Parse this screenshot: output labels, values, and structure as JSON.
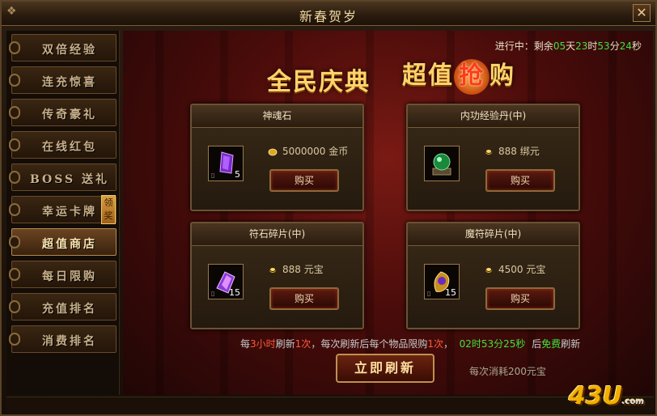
{
  "window": {
    "title": "新春贺岁",
    "close_label": "✕"
  },
  "sidebar": {
    "items": [
      {
        "label": "双倍经验"
      },
      {
        "label": "连充惊喜"
      },
      {
        "label": "传奇豪礼"
      },
      {
        "label": "在线红包"
      },
      {
        "label": "BOSS 送礼"
      },
      {
        "label": "幸运卡牌"
      },
      {
        "label": "超值商店"
      },
      {
        "label": "每日限购"
      },
      {
        "label": "充值排名"
      },
      {
        "label": "消费排名"
      }
    ],
    "active_index": 6,
    "badge": "领奖"
  },
  "countdown": {
    "prefix": "进行中：剩余",
    "days": "05",
    "days_unit": "天",
    "hours": "23",
    "hours_unit": "时",
    "minutes": "53",
    "minutes_unit": "分",
    "seconds": "24",
    "seconds_unit": "秒"
  },
  "banner": {
    "left": "全民庆典",
    "right_a": "超值",
    "right_circle": "抢",
    "right_b": "购"
  },
  "products": [
    {
      "name": "神魂石",
      "qty": "5",
      "price": "5000000",
      "currency": "金币",
      "currency_icon": "gold-coin-icon",
      "item_icon": "purple-crystal-icon",
      "buy_label": "购买"
    },
    {
      "name": "内功经验丹(中)",
      "qty": "",
      "price": "888",
      "currency": "绑元",
      "currency_icon": "yuanbao-icon",
      "item_icon": "green-orb-icon",
      "buy_label": "购买"
    },
    {
      "name": "符石碎片(中)",
      "qty": "15",
      "price": "888",
      "currency": "元宝",
      "currency_icon": "yuanbao-icon",
      "item_icon": "purple-shard-icon",
      "buy_label": "购买"
    },
    {
      "name": "魔符碎片(中)",
      "qty": "15",
      "price": "4500",
      "currency": "元宝",
      "currency_icon": "yuanbao-icon",
      "item_icon": "gold-shard-icon",
      "buy_label": "购买"
    }
  ],
  "refresh": {
    "t1": "每",
    "hours": "3小时",
    "t2": "刷新",
    "times": "1次",
    "t3": "，每次刷新后每个物品限购",
    "limit": "1次",
    "t4": "，",
    "timer": "02时53分25秒",
    "t5": "后",
    "free": "免费",
    "t6": "刷新",
    "button_label": "立即刷新",
    "cost_text": "每次消耗200元宝"
  },
  "logo": {
    "text": "43U",
    "suffix": ".com"
  },
  "colors": {
    "accent_gold": "#ffd36a",
    "highlight_green": "#3ee23e",
    "highlight_red": "#ff5a3a"
  }
}
